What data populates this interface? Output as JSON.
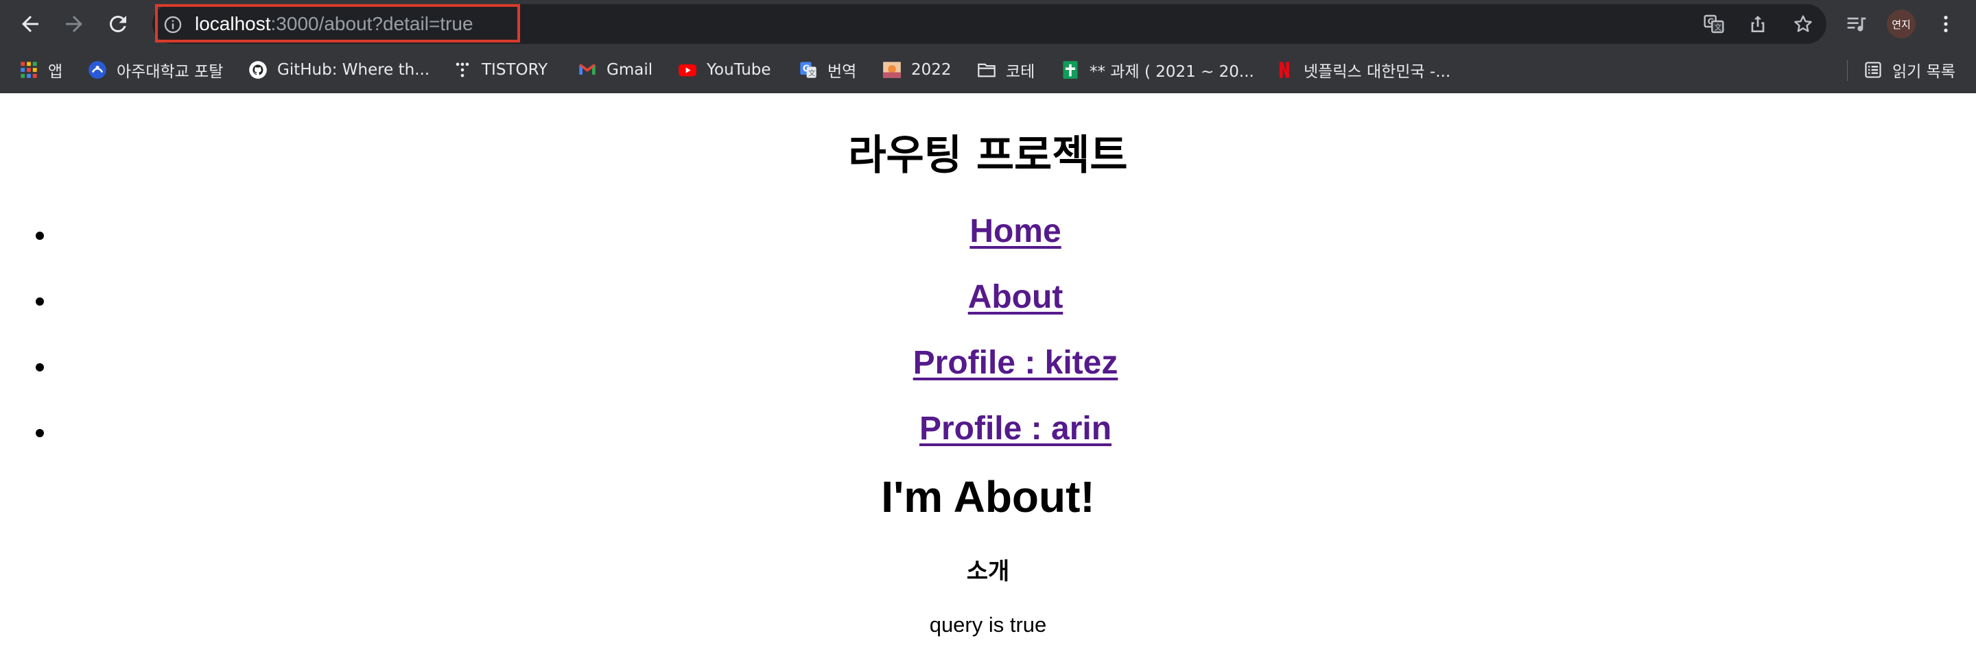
{
  "browser": {
    "url_host": "localhost",
    "url_rest": ":3000/about?detail=true",
    "profile_initials": "연지",
    "highlight_color": "#d93a2b"
  },
  "bookmarks": [
    {
      "label": "앱",
      "icon": "apps-grid-icon"
    },
    {
      "label": "아주대학교 포탈",
      "icon": "ajou-logo-icon"
    },
    {
      "label": "GitHub: Where th...",
      "icon": "github-icon"
    },
    {
      "label": "TISTORY",
      "icon": "tistory-icon"
    },
    {
      "label": "Gmail",
      "icon": "gmail-icon"
    },
    {
      "label": "YouTube",
      "icon": "youtube-icon"
    },
    {
      "label": "번역",
      "icon": "google-translate-icon"
    },
    {
      "label": "2022",
      "icon": "image-thumbnail-icon"
    },
    {
      "label": "코테",
      "icon": "folder-icon"
    },
    {
      "label": "** 과제 ( 2021 ~ 20...",
      "icon": "sheets-icon"
    },
    {
      "label": "넷플릭스 대한민국 -...",
      "icon": "netflix-icon"
    }
  ],
  "reading_list_label": "읽기 목록",
  "page": {
    "title": "라우팅 프로젝트",
    "nav": [
      {
        "label": "Home"
      },
      {
        "label": "About"
      },
      {
        "label": "Profile : kitez"
      },
      {
        "label": "Profile : arin"
      }
    ],
    "heading": "I'm About!",
    "subheading": "소개",
    "query_text": "query is true",
    "link_color": "#551a8b"
  }
}
